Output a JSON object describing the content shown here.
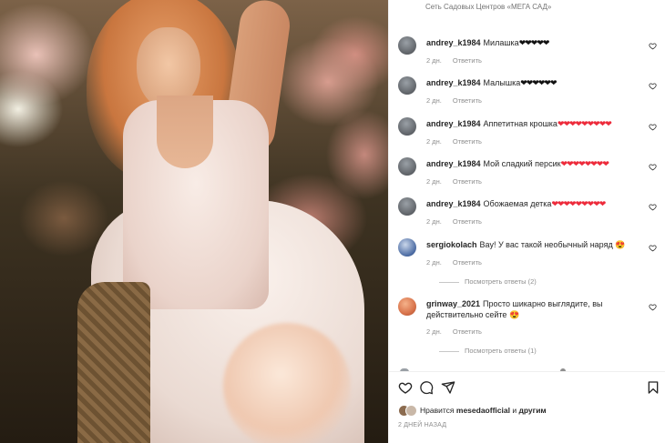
{
  "header": {
    "caption": "Сеть Садовых Центров «МЕГА САД»"
  },
  "comments": [
    {
      "user": "andrey_k1984",
      "text": "Милашка",
      "hearts": "❤❤❤❤❤",
      "hearts_color": "#111111",
      "time": "2 дн.",
      "reply": "Ответить"
    },
    {
      "user": "andrey_k1984",
      "text": "Малышка",
      "hearts": "❤❤❤❤❤❤",
      "hearts_color": "#111111",
      "time": "2 дн.",
      "reply": "Ответить"
    },
    {
      "user": "andrey_k1984",
      "text": "Аппетитная крошка",
      "hearts": "❤❤❤❤❤❤❤❤❤",
      "hearts_color": "#ed2a3a",
      "time": "2 дн.",
      "reply": "Ответить"
    },
    {
      "user": "andrey_k1984",
      "text": "Мой сладкий персик",
      "hearts": "❤❤❤❤❤❤❤❤",
      "hearts_color": "#ed2a3a",
      "time": "2 дн.",
      "reply": "Ответить"
    },
    {
      "user": "andrey_k1984",
      "text": "Обожаемая детка",
      "hearts": "❤❤❤❤❤❤❤❤❤",
      "hearts_color": "#ed2a3a",
      "time": "2 дн.",
      "reply": "Ответить"
    },
    {
      "user": "sergiokolach",
      "text": "Вау! У вас такой необычный наряд",
      "hearts": "😍",
      "hearts_color": "",
      "time": "2 дн.",
      "reply": "Ответить",
      "view_replies": "Посмотреть ответы (2)"
    },
    {
      "user": "grinway_2021",
      "text": "Просто шикарно выглядите, вы действительно сейте",
      "hearts": "😍",
      "hearts_color": "",
      "time": "2 дн.",
      "reply": "Ответить",
      "view_replies": "Посмотреть ответы (1)"
    }
  ],
  "likes": {
    "prefix": "Нравится",
    "user": "mesedaofficial",
    "conj": "и",
    "suffix": "другим"
  },
  "post_time": "2 ДНЕЙ НАЗАД",
  "icons": {
    "like": "heart-icon",
    "comment": "comment-icon",
    "share": "share-icon",
    "save": "bookmark-icon"
  }
}
